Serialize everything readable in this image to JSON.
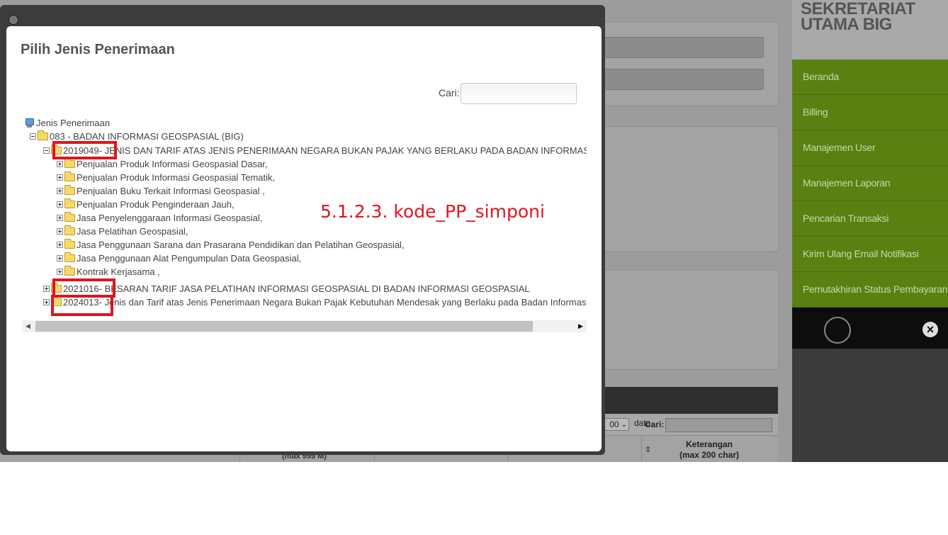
{
  "background_app": {
    "length_value": "00",
    "data_label": "data",
    "search_label": "Cari:",
    "col_keterangan": "Keterangan\n(max 200 char)",
    "col_cut_label": "(max 999 M)"
  },
  "sidebar": {
    "brand": "SEKRETARIAT UTAMA BIG",
    "items": [
      {
        "label": "Beranda"
      },
      {
        "label": "Billing"
      },
      {
        "label": "Manajemen User"
      },
      {
        "label": "Manajemen Laporan"
      },
      {
        "label": "Pencarian Transaksi"
      },
      {
        "label": "Kirim Ulang Email Notifikasi"
      },
      {
        "label": "Pemutakhiran Status Pembayaran"
      }
    ],
    "accent_color": "#5a8012"
  },
  "modal": {
    "title": "Pilih Jenis Penerimaan",
    "search_label": "Cari:",
    "search_value": "",
    "tree": {
      "root": "Jenis Penerimaan",
      "org": "083 - BADAN INFORMASI GEOSPASIAL (BIG)",
      "pp": [
        {
          "code": "2019049",
          "label": " - JENIS DAN TARIF ATAS JENIS PENERIMAAN NEGARA BUKAN PAJAK YANG BERLAKU PADA BADAN INFORMASI GEOSPASIAL",
          "children": [
            "Penjualan Produk Informasi Geospasial Dasar,",
            "Penjualan Produk Informasi Geospasial Tematik,",
            "Penjualan Buku Terkait Informasi Geospasial ,",
            "Penjualan Produk Penginderaan Jauh,",
            "Jasa Penyelenggaraan Informasi Geospasial,",
            "Jasa Pelatihan Geospasial,",
            "Jasa Penggunaan Sarana dan Prasarana Pendidikan dan Pelatihan Geospasial,",
            "Jasa Penggunaan Alat Pengumpulan Data Geospasial,",
            "Kontrak Kerjasama ,"
          ]
        },
        {
          "code": "2021016",
          "label": " - BESARAN TARIF JASA PELATIHAN INFORMASI GEOSPASIAL DI BADAN INFORMASI GEOSPASIAL"
        },
        {
          "code": "2024013",
          "label": " - Jenis dan Tarif atas Jenis Penerimaan Negara Bukan Pajak Kebutuhan Mendesak yang Berlaku pada Badan Informasi Geospasial"
        }
      ]
    },
    "annotation": "5.1.2.3. kode_PP_simponi",
    "annotation_color": "#e0141e"
  }
}
